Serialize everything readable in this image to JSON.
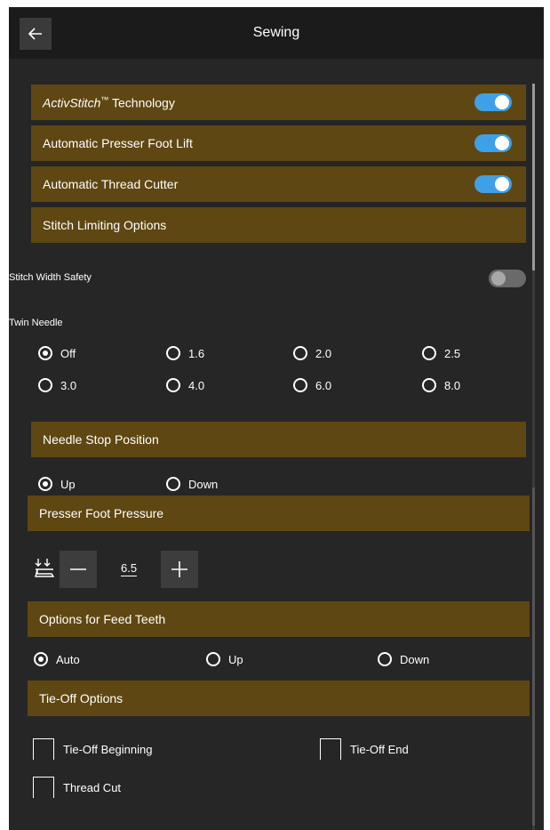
{
  "window": {
    "title": "Sewing"
  },
  "sections": {
    "activstitch": {
      "brand": "ActivStitch",
      "tm": "™",
      "rest": " Technology",
      "toggle": "on"
    },
    "presser_lift": {
      "label": "Automatic Presser Foot Lift",
      "toggle": "on"
    },
    "thread_cutter": {
      "label": "Automatic Thread Cutter",
      "toggle": "on"
    },
    "stitch_limiting": {
      "label": "Stitch Limiting Options"
    },
    "width_safety": {
      "label": "Stitch Width Safety",
      "toggle": "off"
    },
    "twin_needle": {
      "label": "Twin Needle",
      "options": [
        "Off",
        "1.6",
        "2.0",
        "2.5",
        "3.0",
        "4.0",
        "6.0",
        "8.0"
      ],
      "selected": "Off"
    },
    "needle_stop": {
      "label": "Needle Stop Position",
      "options": [
        "Up",
        "Down"
      ],
      "selected": "Up"
    },
    "presser_pressure": {
      "label": "Presser Foot Pressure",
      "value": "6.5"
    },
    "feed_teeth": {
      "label": "Options for Feed Teeth",
      "options": [
        "Auto",
        "Up",
        "Down"
      ],
      "selected": "Auto"
    },
    "tie_off": {
      "label": "Tie-Off Options",
      "options": [
        "Tie-Off Beginning",
        "Tie-Off End",
        "Thread Cut"
      ]
    }
  },
  "colors": {
    "header_bg": "#5e4712",
    "toggle_on": "#3fa0e8",
    "panel_bg": "#262626",
    "titlebar_bg": "#1b1b1b"
  },
  "icons": [
    "back-arrow-icon",
    "presser-foot-icon",
    "minus-icon",
    "plus-icon"
  ]
}
